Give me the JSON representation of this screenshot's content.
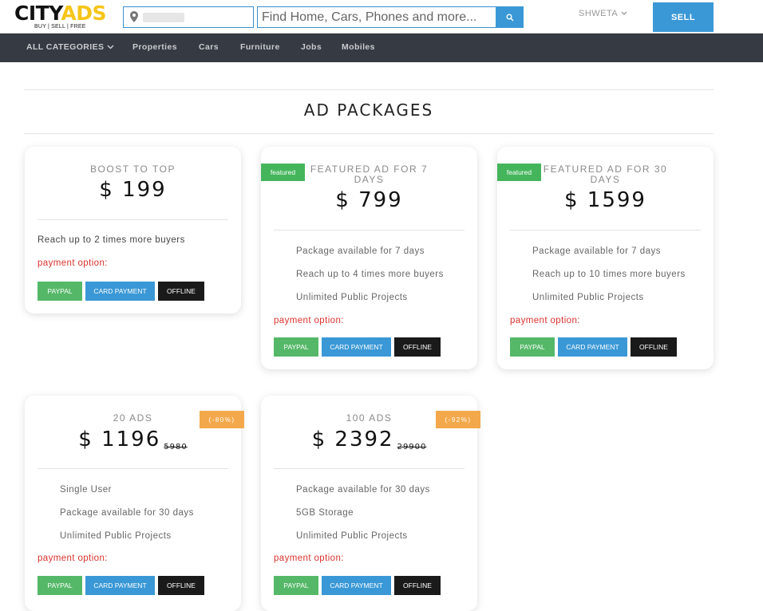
{
  "header": {
    "logo_city": "CITY",
    "logo_ads": "ADS",
    "logo_tagline": "BUY | SELL | FREE",
    "search_placeholder": "Find Home, Cars, Phones and more...",
    "user_name": "SHWETA",
    "sell_label": "SELL",
    "accent_color": "#3a98d6"
  },
  "nav": {
    "all_categories": "ALL CATEGORIES",
    "items": [
      "Properties",
      "Cars",
      "Furniture",
      "Jobs",
      "Mobiles"
    ]
  },
  "page_title": "AD PACKAGES",
  "payment_label": "payment option:",
  "payment_buttons": {
    "paypal": "PAYPAL",
    "card": "CARD PAYMENT",
    "offline": "OFFLINE"
  },
  "packages": [
    {
      "name": "BOOST TO TOP",
      "price": "$ 199",
      "features": [
        "Reach up to 2 times more buyers"
      ]
    },
    {
      "badge": "featured",
      "name": "FEATURED AD FOR 7 DAYS",
      "price": "$ 799",
      "features": [
        "Package available for 7 days",
        "Reach up to 4 times more buyers",
        "Unlimited Public Projects"
      ]
    },
    {
      "badge": "featured",
      "name": "FEATURED AD FOR 30 DAYS",
      "price": "$ 1599",
      "features": [
        "Package available for 7 days",
        "Reach up to 10 times more buyers",
        "Unlimited Public Projects"
      ]
    },
    {
      "discount": "(-80%)",
      "name": "20 ADS",
      "price": "$ 1196",
      "old_price": "5980",
      "features": [
        "Single User",
        "Package available for 30 days",
        "Unlimited Public Projects"
      ]
    },
    {
      "discount": "(-92%)",
      "name": "100 ADS",
      "price": "$ 2392",
      "old_price": "29900",
      "features": [
        "Package available for 30 days",
        "5GB Storage",
        "Unlimited Public Projects"
      ]
    }
  ]
}
